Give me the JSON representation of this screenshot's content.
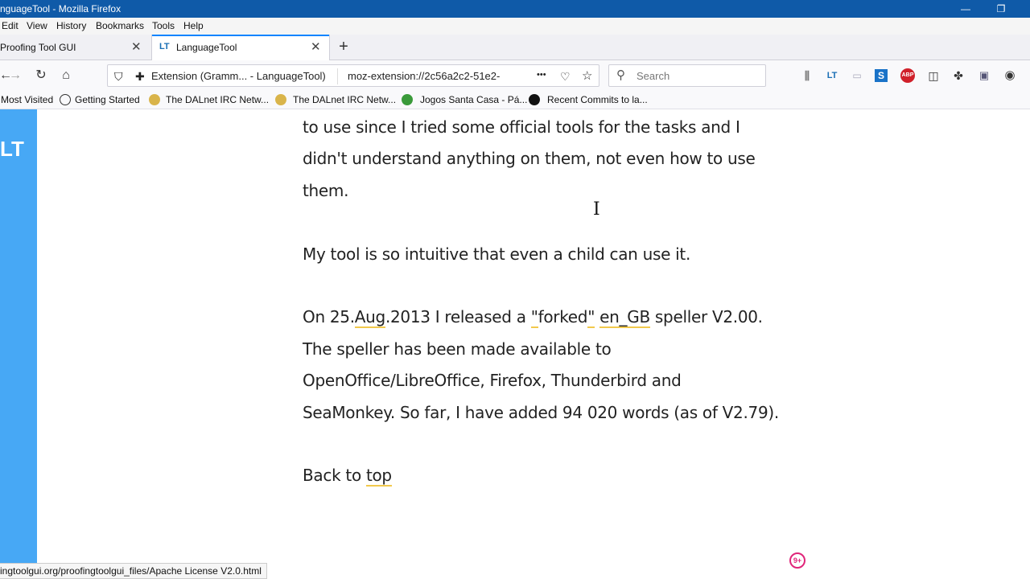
{
  "window": {
    "title": "nguageTool - Mozilla Firefox",
    "minimize_glyph": "—",
    "restore_glyph": "❐"
  },
  "menu": [
    "Edit",
    "View",
    "History",
    "Bookmarks",
    "Tools",
    "Help"
  ],
  "tabs": [
    {
      "label": "Proofing Tool GUI",
      "close": "✕"
    },
    {
      "label": "LanguageTool",
      "close": "✕",
      "icon": "LT"
    }
  ],
  "newtab": "+",
  "nav": {
    "back": "←",
    "forward": "→",
    "reload": "↻",
    "home": "⌂"
  },
  "urlbar": {
    "extension_label": "Extension (Gramm... - LanguageTool)",
    "url": "moz-extension://2c56a2c2-51e2-",
    "more": "•••"
  },
  "search": {
    "placeholder": "Search"
  },
  "bookmarks": [
    "Most Visited",
    "Getting Started",
    "The DALnet IRC Netw...",
    "The DALnet IRC Netw...",
    "Jogos Santa Casa - Pá...",
    "Recent Commits to la..."
  ],
  "sidebar": {
    "logo": "LT"
  },
  "article": {
    "p1": [
      "to use since I tried some official tools for the tasks and I",
      "didn't understand anything on them, not even how to use",
      "them."
    ],
    "p2": "My tool is so intuitive that even a child can use it.",
    "p3_l1": {
      "a": "On 25.",
      "b": "Aug",
      "c": ".2013 I released a ",
      "d": "\"",
      "e": "forked",
      "f": "\"",
      "g": " ",
      "h": "en_GB",
      "i": " speller V2.00."
    },
    "p3_rest": [
      "The speller has been made available to",
      "OpenOffice/LibreOffice, Firefox, Thunderbird and",
      "SeaMonkey. So far, I have added 94 020 words (as of V2.79)."
    ],
    "back": {
      "a": "Back to ",
      "b": "top"
    }
  },
  "status": "ingtoolgui.org/proofingtoolgui_files/Apache License V2.0.html",
  "badge": "9+",
  "colors": {
    "titlebar": "#0f5aa8",
    "sidebar": "#47a8f5",
    "underline": "#f2c94c",
    "badge": "#e0257a"
  }
}
